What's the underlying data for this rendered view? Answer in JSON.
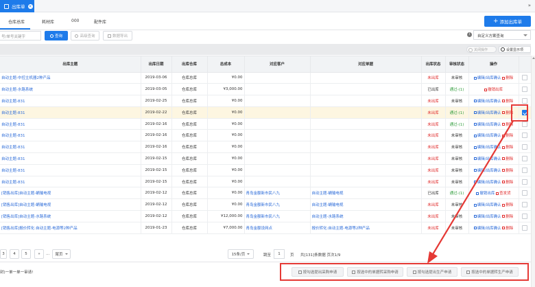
{
  "top_tab": {
    "label": "出库单",
    "close": "×"
  },
  "collapse_label": "»",
  "subtabs": [
    {
      "label": "仓库总库"
    },
    {
      "label": "耗材库"
    },
    {
      "label": "000"
    },
    {
      "label": "配件库"
    }
  ],
  "add_button": "添加出库单",
  "toolbar": {
    "search_placeholder": "号/单号关键字",
    "search_label": "查询",
    "advanced_label": "高级查询",
    "export_label": "数据导出",
    "scheme_label": "自定义方案查询"
  },
  "grid_tools": {
    "close_bar": "关闭操作",
    "settings": "设置显示项"
  },
  "table": {
    "columns": [
      "出库主题",
      "出库日期",
      "出库仓库",
      "总成本",
      "对应客户",
      "对应单据",
      "出库状态",
      "审核状态",
      "操作"
    ],
    "rows": [
      {
        "subject": "自动主题-中控主机器2种产品",
        "date": "2019-03-06",
        "warehouse": "仓库总库",
        "cost": "¥0.00",
        "customer": "",
        "doc": "",
        "status": "未出库",
        "review": "未审核",
        "ops": "编辑/出库确认",
        "ops2": "删除",
        "selected": false
      },
      {
        "subject": "自动主题-水路系统",
        "date": "2019-03-05",
        "warehouse": "仓库总库",
        "cost": "¥3,000.00",
        "customer": "",
        "doc": "",
        "status": "已出库",
        "review": "通过-(1)",
        "ops": "",
        "ops2": "撤销出库",
        "selected": false
      },
      {
        "subject": "自动主题-831",
        "date": "2019-02-25",
        "warehouse": "仓库总库",
        "cost": "¥0.00",
        "customer": "",
        "doc": "",
        "status": "未出库",
        "review": "未审核",
        "ops": "编辑/出库确认",
        "ops2": "删除",
        "selected": false
      },
      {
        "subject": "自动主题-831",
        "date": "2019-02-22",
        "warehouse": "仓库总库",
        "cost": "¥0.00",
        "customer": "",
        "doc": "",
        "status": "未出库",
        "review": "通过-(1)",
        "ops": "编辑/出库确认",
        "ops2": "删除",
        "selected": true
      },
      {
        "subject": "自动主题-831",
        "date": "2019-02-16",
        "warehouse": "仓库总库",
        "cost": "¥0.00",
        "customer": "",
        "doc": "",
        "status": "未出库",
        "review": "通过-(1)",
        "ops": "编辑/出库确认",
        "ops2": "删除",
        "selected": false
      },
      {
        "subject": "自动主题-831",
        "date": "2019-02-16",
        "warehouse": "仓库总库",
        "cost": "¥0.00",
        "customer": "",
        "doc": "",
        "status": "未出库",
        "review": "未审核",
        "ops": "编辑/出库确认",
        "ops2": "删除",
        "selected": false
      },
      {
        "subject": "自动主题-831",
        "date": "2019-02-16",
        "warehouse": "仓库总库",
        "cost": "¥0.00",
        "customer": "",
        "doc": "",
        "status": "未出库",
        "review": "未审核",
        "ops": "编辑/出库确认",
        "ops2": "删除",
        "selected": false
      },
      {
        "subject": "自动主题-831",
        "date": "2019-02-15",
        "warehouse": "仓库总库",
        "cost": "¥0.00",
        "customer": "",
        "doc": "",
        "status": "未出库",
        "review": "未审核",
        "ops": "编辑/出库确认",
        "ops2": "删除",
        "selected": false
      },
      {
        "subject": "自动主题-831",
        "date": "2019-02-15",
        "warehouse": "仓库总库",
        "cost": "¥0.00",
        "customer": "",
        "doc": "",
        "status": "未出库",
        "review": "未审核",
        "ops": "编辑/出库确认",
        "ops2": "删除",
        "selected": false
      },
      {
        "subject": "自动主题-831",
        "date": "2019-02-15",
        "warehouse": "仓库总库",
        "cost": "¥0.00",
        "customer": "",
        "doc": "",
        "status": "未出库",
        "review": "未审核",
        "ops": "编辑/出库确认",
        "ops2": "删除",
        "selected": false
      },
      {
        "subject": "[销售出库]自动主题-蜗输电视",
        "date": "2019-02-12",
        "warehouse": "仓库总库",
        "cost": "¥0.00",
        "customer": "青岛金额新市民八九",
        "doc": "自动主题-蜗输电视",
        "status": "已出库",
        "review": "通过-(1)",
        "ops": "撤销出库",
        "ops2": "查发货",
        "selected": false
      },
      {
        "subject": "[销售出库]自动主题-蜗输电视",
        "date": "2019-02-12",
        "warehouse": "仓库总库",
        "cost": "¥0.00",
        "customer": "青岛金额新市民八九",
        "doc": "自动主题-蜗输电视",
        "status": "未出库",
        "review": "未审核",
        "ops": "编辑/出库确认",
        "ops2": "删除",
        "selected": false
      },
      {
        "subject": "[销售出库]自动主题-水路系统",
        "date": "2019-02-12",
        "warehouse": "仓库总库",
        "cost": "¥12,000.00",
        "customer": "青岛金额新市民八九",
        "doc": "自动主题-水路系统",
        "status": "未出库",
        "review": "未审核",
        "ops": "编辑/出库确认",
        "ops2": "删除",
        "selected": false
      },
      {
        "subject": "[销售出库]报价转化:自动主题-电源等2种产品",
        "date": "2019-01-23",
        "warehouse": "仓库总库",
        "cost": "¥7,000.00",
        "customer": "青岛金额设网点",
        "doc": "报价转化:自动主题-电源等2种产品",
        "status": "未出库",
        "review": "未审核",
        "ops": "编辑/出库确认",
        "ops2": "删除",
        "selected": false
      }
    ]
  },
  "pager": {
    "pages": [
      "3",
      "4",
      "5",
      "»",
      "..."
    ],
    "last_page": "尾页",
    "per_page": "15条/页",
    "jump_label": "跳至",
    "jump_value": "1",
    "page_unit": "页",
    "summary": "共[131]条数据  页次1/9"
  },
  "footer": {
    "text": "封)一单一单一审请!",
    "buttons": [
      "按勾选提出采购申请",
      "按选中的单据转采购申请",
      "按勾选提出生产申请",
      "按选中的单据转生产申请"
    ]
  },
  "colors": {
    "primary": "#1e7bea",
    "danger": "#e02a2a",
    "success": "#2f9c3b",
    "annotation": "#e53935"
  }
}
